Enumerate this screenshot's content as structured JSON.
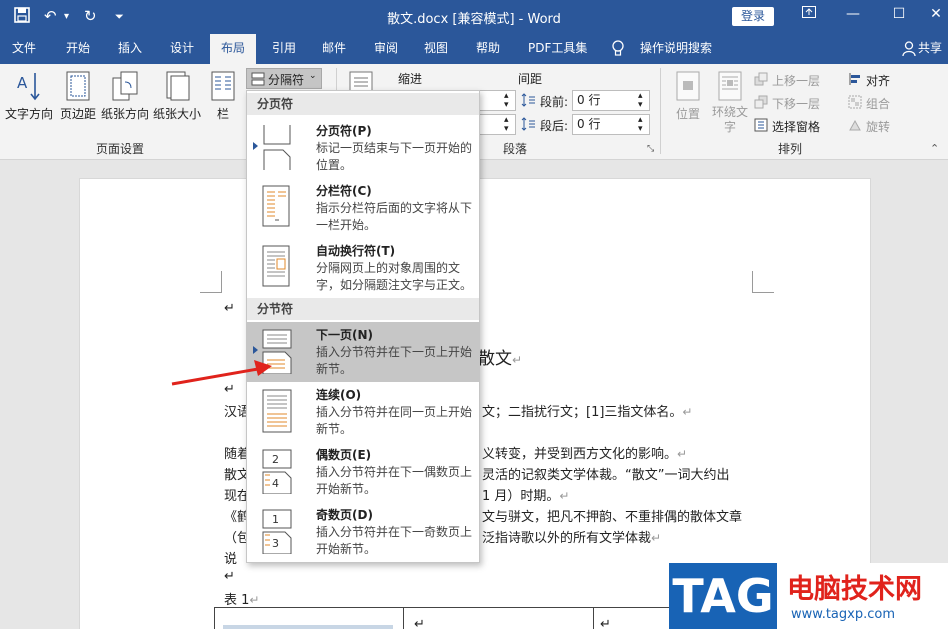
{
  "window": {
    "title": "散文.docx [兼容模式] - Word",
    "login_label": "登录",
    "share_label": "共享",
    "undo_glyph": "↶",
    "redo_glyph": "↻",
    "customize_glyph": "⏷"
  },
  "tabs": [
    {
      "label": "文件"
    },
    {
      "label": "开始"
    },
    {
      "label": "插入"
    },
    {
      "label": "设计"
    },
    {
      "label": "布局",
      "active": true
    },
    {
      "label": "引用"
    },
    {
      "label": "邮件"
    },
    {
      "label": "审阅"
    },
    {
      "label": "视图"
    },
    {
      "label": "帮助"
    },
    {
      "label": "PDF工具集"
    },
    {
      "label": "操作说明搜索"
    }
  ],
  "ribbon": {
    "page_setup": {
      "text_direction": "文字方向",
      "margins": "页边距",
      "orientation": "纸张方向",
      "size": "纸张大小",
      "columns": "栏",
      "breaks": "分隔符",
      "group_label": "页面设置"
    },
    "paragraph": {
      "indent_label": "缩进",
      "spacing_label": "间距",
      "before_label": "段前:",
      "before_value": "0 行",
      "after_label": "段后:",
      "after_value": "0 行",
      "group_label": "段落"
    },
    "arrange": {
      "position": "位置",
      "wrap_text_1": "环绕文",
      "wrap_text_2": "字",
      "bring_forward": "上移一层",
      "send_backward": "下移一层",
      "selection_pane": "选择窗格",
      "align": "对齐",
      "group": "组合",
      "rotate": "旋转",
      "group_label": "排列"
    }
  },
  "breaks_menu": {
    "page_breaks_header": "分页符",
    "section_breaks_header": "分节符",
    "items": [
      {
        "title": "分页符(P)",
        "desc": "标记一页结束与下一页开始的位置。"
      },
      {
        "title": "分栏符(C)",
        "desc": "指示分栏符后面的文字将从下一栏开始。"
      },
      {
        "title": "自动换行符(T)",
        "desc": "分隔网页上的对象周围的文字，如分隔题注文字与正文。"
      },
      {
        "title": "下一页(N)",
        "desc": "插入分节符并在下一页上开始新节。",
        "selected": true
      },
      {
        "title": "连续(O)",
        "desc": "插入分节符并在同一页上开始新节。"
      },
      {
        "title": "偶数页(E)",
        "desc": "插入分节符并在下一偶数页上开始新节。"
      },
      {
        "title": "奇数页(D)",
        "desc": "插入分节符并在下一奇数页上开始新节。"
      }
    ]
  },
  "document": {
    "heading": "散文",
    "para_mark": "↵",
    "lines": [
      {
        "left": "汉语",
        "right": "文；二指扰行文；[1]三指文体名。"
      },
      {
        "left": "随着",
        "right": "义转变，并受到西方文化的影响。"
      },
      {
        "left": "散文",
        "right": "灵活的记叙类文学体裁。“散文”一词大约出"
      },
      {
        "left": "现在",
        "right": "1 月）时期。"
      },
      {
        "left": "《鹤",
        "right": "文与骈文，把凡不押韵、不重排偶的散体文章"
      },
      {
        "left": "（包",
        "right": "泛指诗歌以外的所有文学体裁"
      },
      {
        "left": "说",
        "right": ""
      }
    ],
    "table_caption": "表  1"
  },
  "watermark": {
    "tag": "TAG",
    "title": "电脑技术网",
    "url": "www.tagxp.com"
  },
  "colors": {
    "accent": "#2b579a",
    "arrow": "#e0231c",
    "watermark_blue": "#1863b5"
  }
}
